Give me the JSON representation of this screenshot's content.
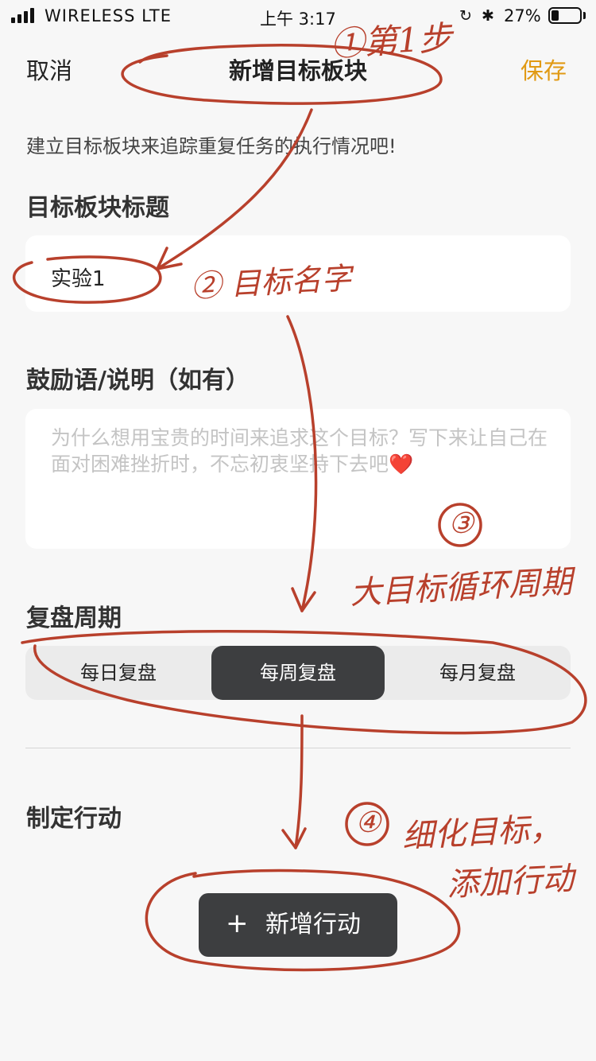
{
  "status_bar": {
    "carrier": "WIRELESS   LTE",
    "time": "上午 3:17",
    "battery": "27%",
    "icons": [
      "signal-bars-icon",
      "orientation-lock-icon",
      "bluetooth-icon",
      "battery-icon"
    ]
  },
  "nav": {
    "cancel": "取消",
    "title": "新增目标板块",
    "save": "保存",
    "save_color": "#e19a14"
  },
  "form": {
    "hint": "建立目标板块来追踪重复任务的执行情况吧!",
    "title_label": "目标板块标题",
    "title_value": "实验1",
    "motto_label": "鼓励语/说明（如有）",
    "motto_placeholder": "为什么想用宝贵的时间来追求这个目标？写下来让自己在面对困难挫折时，不忘初衷坚持下去吧❤️",
    "cycle_label": "复盘周期",
    "cycle_options": [
      "每日复盘",
      "每周复盘",
      "每月复盘"
    ],
    "cycle_selected": "每周复盘",
    "action_label": "制定行动",
    "add_action_plus": "+",
    "add_action": "新增行动"
  },
  "annotations": {
    "step1": "①第1步",
    "step2": "② 目标名字",
    "step3_num": "③",
    "step3": "大目标循环周期",
    "step4_num": "④",
    "step4_line1": "细化目标，",
    "step4_line2": "添加行动",
    "ink_color": "#b8402c"
  }
}
